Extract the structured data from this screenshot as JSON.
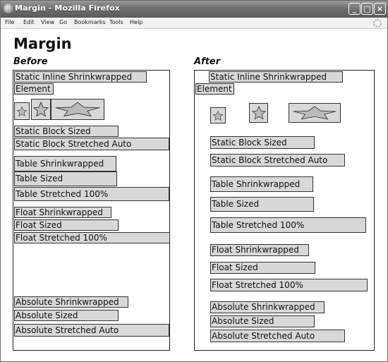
{
  "window": {
    "title": "Margin - Mozilla Firefox"
  },
  "menu": [
    "File",
    "Edit",
    "View",
    "Go",
    "Bookmarks",
    "Tools",
    "Help"
  ],
  "page": {
    "heading": "Margin",
    "before_label": "Before",
    "after_label": "After"
  },
  "items": {
    "inline_line1": "Static Inline Shrinkwrapped",
    "inline_line2": "Element",
    "static_block_sized": "Static Block Sized",
    "static_block_stretched": "Static Block Stretched Auto",
    "table_shrink": "Table Shrinkwrapped",
    "table_sized": "Table Sized",
    "table_stretched": "Table Stretched 100%",
    "float_shrink": "Float Shrinkwrapped",
    "float_sized": "Float Sized",
    "float_stretched": "Float Stretched 100%",
    "abs_shrink": "Absolute Shrinkwrapped",
    "abs_sized": "Absolute Sized",
    "abs_stretched": "Absolute Stretched Auto"
  },
  "icons": {
    "star": "star-icon",
    "window_controls": [
      "minimize-icon",
      "maximize-icon",
      "close-icon"
    ]
  }
}
